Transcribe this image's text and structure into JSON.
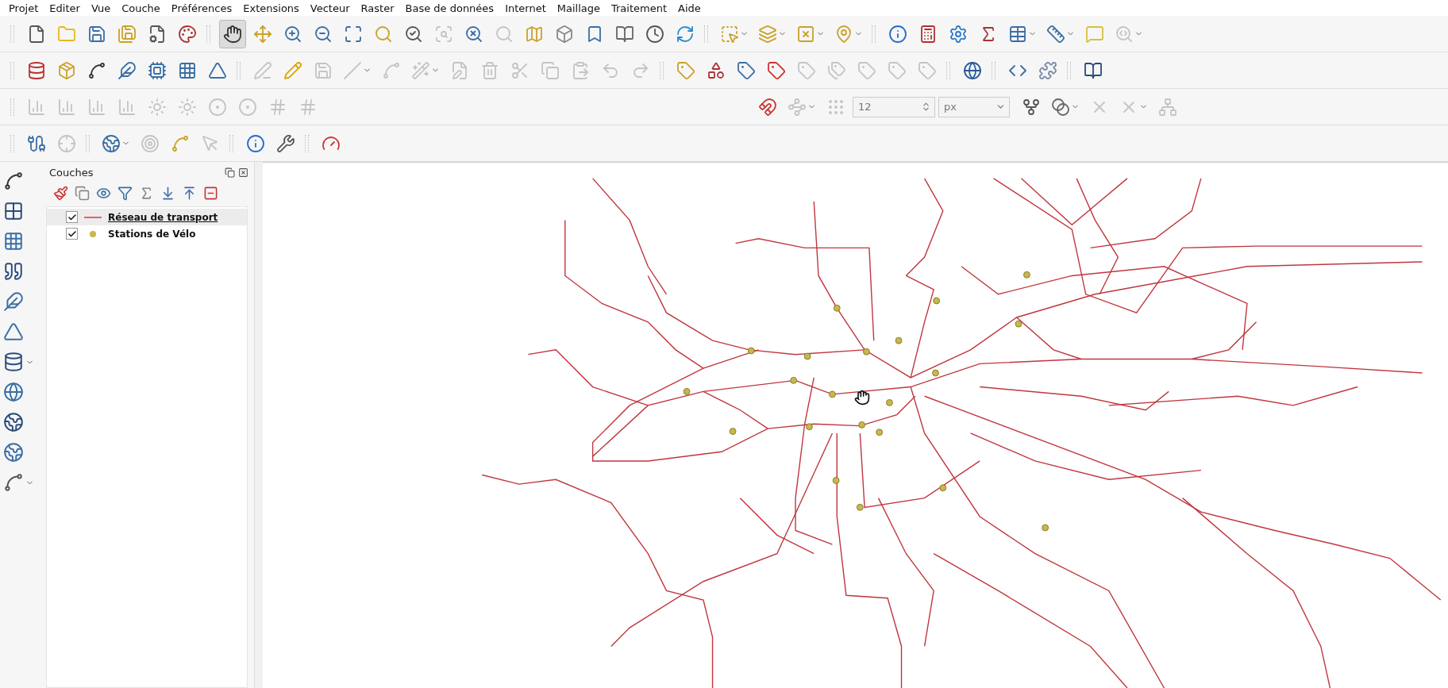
{
  "menu": [
    {
      "label": "Projet"
    },
    {
      "label": "Editer"
    },
    {
      "label": "Vue"
    },
    {
      "label": "Couche"
    },
    {
      "label": "Préférences"
    },
    {
      "label": "Extensions"
    },
    {
      "label": "Vecteur"
    },
    {
      "label": "Raster"
    },
    {
      "label": "Base de données"
    },
    {
      "label": "Internet"
    },
    {
      "label": "Maillage"
    },
    {
      "label": "Traitement"
    },
    {
      "label": "Aide"
    }
  ],
  "toolbars": [
    {
      "groups": [
        {
          "items": [
            {
              "disabled": false,
              "active": false
            },
            {
              "disabled": false,
              "active": false
            },
            {
              "disabled": false,
              "active": false
            },
            {
              "disabled": false,
              "active": false
            },
            {
              "disabled": false,
              "active": false
            },
            {
              "disabled": false,
              "active": false
            }
          ]
        },
        {
          "items": [
            {
              "disabled": false,
              "active": true
            },
            {
              "disabled": false,
              "active": false
            },
            {
              "disabled": false,
              "active": false
            },
            {
              "disabled": false,
              "active": false
            },
            {
              "disabled": false,
              "active": false
            },
            {
              "disabled": false,
              "active": false
            },
            {
              "disabled": false,
              "active": false
            },
            {
              "disabled": true,
              "active": false
            },
            {
              "disabled": false,
              "active": false
            },
            {
              "disabled": true,
              "active": false
            },
            {
              "disabled": false,
              "active": false
            },
            {
              "disabled": false,
              "active": false
            },
            {
              "disabled": false,
              "active": false
            },
            {
              "disabled": false,
              "active": false
            },
            {
              "disabled": false,
              "active": false
            },
            {
              "disabled": false,
              "active": false
            }
          ]
        },
        {
          "items": [
            {
              "disabled": false,
              "active": false,
              "dropdown": true
            },
            {
              "disabled": false,
              "active": false,
              "dropdown": true
            },
            {
              "disabled": false,
              "active": false,
              "dropdown": true
            },
            {
              "disabled": false,
              "active": false,
              "dropdown": true
            }
          ]
        },
        {
          "items": [
            {
              "disabled": false,
              "active": false
            },
            {
              "disabled": false,
              "active": false
            },
            {
              "disabled": false,
              "active": false
            },
            {
              "disabled": false,
              "active": false
            },
            {
              "disabled": false,
              "active": false,
              "dropdown": true
            },
            {
              "disabled": false,
              "active": false,
              "dropdown": true
            },
            {
              "disabled": false,
              "active": false
            },
            {
              "disabled": true,
              "active": false,
              "dropdown": true
            }
          ]
        }
      ]
    },
    {
      "groups": [
        {
          "items": [
            {
              "disabled": false,
              "active": false
            },
            {
              "disabled": false,
              "active": false
            },
            {
              "disabled": false,
              "active": false
            },
            {
              "disabled": false,
              "active": false
            },
            {
              "disabled": false,
              "active": false
            },
            {
              "disabled": false,
              "active": false
            },
            {
              "disabled": false,
              "active": false
            }
          ]
        },
        {
          "items": [
            {
              "disabled": true,
              "active": false
            },
            {
              "disabled": false,
              "active": false
            },
            {
              "disabled": true,
              "active": false
            },
            {
              "disabled": true,
              "active": false,
              "dropdown": true
            },
            {
              "disabled": true,
              "active": false
            },
            {
              "disabled": true,
              "active": false,
              "dropdown": true
            },
            {
              "disabled": true,
              "active": false
            },
            {
              "disabled": true,
              "active": false
            },
            {
              "disabled": true,
              "active": false
            },
            {
              "disabled": true,
              "active": false
            },
            {
              "disabled": true,
              "active": false
            },
            {
              "disabled": true,
              "active": false
            },
            {
              "disabled": true,
              "active": false
            }
          ]
        },
        {
          "items": [
            {
              "disabled": false,
              "active": false
            },
            {
              "disabled": false,
              "active": false
            },
            {
              "disabled": false,
              "active": false
            },
            {
              "disabled": false,
              "active": false
            },
            {
              "disabled": true,
              "active": false
            },
            {
              "disabled": true,
              "active": false
            },
            {
              "disabled": true,
              "active": false
            },
            {
              "disabled": true,
              "active": false
            },
            {
              "disabled": true,
              "active": false
            }
          ]
        },
        {
          "items": [
            {
              "disabled": false,
              "active": false
            }
          ]
        },
        {
          "items": [
            {
              "disabled": false,
              "active": false
            },
            {
              "disabled": false,
              "active": false
            }
          ]
        },
        {
          "items": [
            {
              "disabled": false,
              "active": false
            }
          ]
        }
      ]
    },
    {
      "groups": [
        {
          "items": [
            {
              "disabled": true,
              "active": false
            },
            {
              "disabled": true,
              "active": false
            },
            {
              "disabled": true,
              "active": false
            },
            {
              "disabled": true,
              "active": false
            },
            {
              "disabled": true,
              "active": false
            },
            {
              "disabled": true,
              "active": false
            },
            {
              "disabled": true,
              "active": false
            },
            {
              "disabled": true,
              "active": false
            },
            {
              "disabled": true,
              "active": false
            },
            {
              "disabled": true,
              "active": false
            }
          ]
        }
      ],
      "right_groups": [
        {
          "items": [
            {
              "disabled": false,
              "active": false
            },
            {
              "disabled": true,
              "active": false,
              "dropdown": true
            },
            {
              "disabled": true,
              "active": false
            },
            {
              "kind": "spin",
              "value": "12"
            },
            {
              "kind": "select",
              "value": "px"
            },
            {
              "disabled": false,
              "active": false
            },
            {
              "disabled": false,
              "active": false,
              "dropdown": true
            },
            {
              "disabled": true,
              "active": false
            },
            {
              "disabled": true,
              "active": false,
              "dropdown": true
            },
            {
              "disabled": true,
              "active": false
            }
          ]
        }
      ]
    },
    {
      "groups": [
        {
          "items": [
            {
              "disabled": false,
              "active": false
            },
            {
              "disabled": true,
              "active": false
            }
          ]
        },
        {
          "items": [
            {
              "disabled": false,
              "active": false,
              "dropdown": true
            },
            {
              "disabled": true,
              "active": false
            },
            {
              "disabled": false,
              "active": false
            },
            {
              "disabled": true,
              "active": false
            }
          ]
        },
        {
          "items": [
            {
              "disabled": false,
              "active": false
            },
            {
              "disabled": false,
              "active": false
            }
          ]
        },
        {
          "items": [
            {
              "disabled": false,
              "active": false
            }
          ]
        }
      ]
    }
  ],
  "side_toolbar": [
    {
      "dropdown": false
    },
    {
      "dropdown": false
    },
    {
      "dropdown": false
    },
    {
      "dropdown": false
    },
    {
      "dropdown": false
    },
    {
      "dropdown": false
    },
    {
      "dropdown": true
    },
    {
      "dropdown": false
    },
    {
      "dropdown": false
    },
    {
      "dropdown": false
    },
    {
      "dropdown": true
    }
  ],
  "layers_panel": {
    "title": "Couches",
    "layers": [
      {
        "name": "Réseau de transport",
        "checked": true,
        "selected": true,
        "kind": "line",
        "color": "#e06666"
      },
      {
        "name": "Stations de Vélo",
        "checked": true,
        "selected": false,
        "kind": "point",
        "color": "#c8b84a"
      }
    ]
  }
}
